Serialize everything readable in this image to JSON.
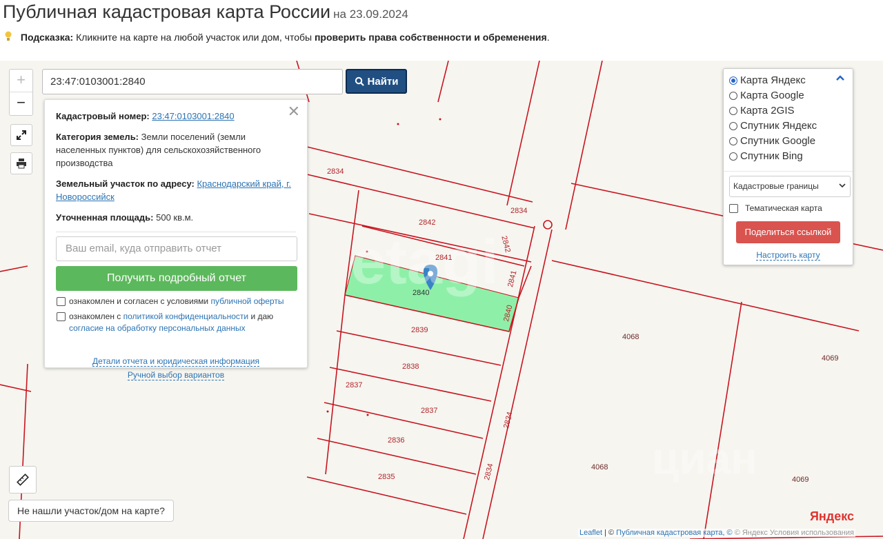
{
  "header": {
    "title": "Публичная кадастровая карта России",
    "date": "на 23.09.2024"
  },
  "hint": {
    "label": "Подсказка:",
    "text": "Кликните на карте на любой участок или дом, чтобы",
    "bold": "проверить права собственности и обременения",
    "end": "."
  },
  "search": {
    "value": "23:47:0103001:2840",
    "button": "Найти"
  },
  "popup": {
    "cadastral_label": "Кадастровый номер:",
    "cadastral_value": "23:47:0103001:2840",
    "category_label": "Категория земель:",
    "category_value": "Земли поселений (земли населенных пунктов) для сельскохозяйственного производства",
    "address_label": "Земельный участок по адресу:",
    "address_value": "Краснодарский край, г. Новороссийск",
    "area_label": "Уточненная площадь:",
    "area_value": "500 кв.м.",
    "email_placeholder": "Ваш email, куда отправить отчет",
    "report_button": "Получить подробный отчет",
    "check1_text": "ознакомлен и согласен с условиями",
    "check1_link": "публичной оферты",
    "check2_text": "ознакомлен с",
    "check2_link": "политикой конфиденциальности",
    "check2_mid": "и даю",
    "check2_link2": "согласие на обработку персональных данных",
    "details_link": "Детали отчета и юридическая информация",
    "manual_link": "Ручной выбор вариантов"
  },
  "layers": {
    "options": [
      {
        "label": "Карта Яндекс",
        "selected": true
      },
      {
        "label": "Карта Google",
        "selected": false
      },
      {
        "label": "Карта 2GIS",
        "selected": false
      },
      {
        "label": "Спутник Яндекс",
        "selected": false
      },
      {
        "label": "Спутник Google",
        "selected": false
      },
      {
        "label": "Спутник Bing",
        "selected": false
      }
    ],
    "boundaries": "Кадастровые границы",
    "thematic": "Тематическая карта",
    "share": "Поделиться ссылкой",
    "setup": "Настроить карту"
  },
  "map": {
    "not_found": "Не нашли участок/дом на карте?",
    "yandex_logo": "Яндекс",
    "attribution_leaflet": "Leaflet",
    "attribution_sep": "| ©",
    "attribution_pkk": "Публичная кадастровая карта, ©",
    "attribution_terms": "© Яндекс  Условия использования",
    "plot_labels": [
      "2834",
      "2842",
      "2834",
      "2842",
      "2841",
      "2841",
      "2840",
      "2840",
      "2839",
      "2838",
      "2837",
      "2837",
      "2836",
      "2835",
      "2834",
      "2834",
      "4068",
      "4069",
      "4068",
      "4069"
    ],
    "highlight_color": "#8ef0a8",
    "boundary_color": "#c8141e"
  }
}
